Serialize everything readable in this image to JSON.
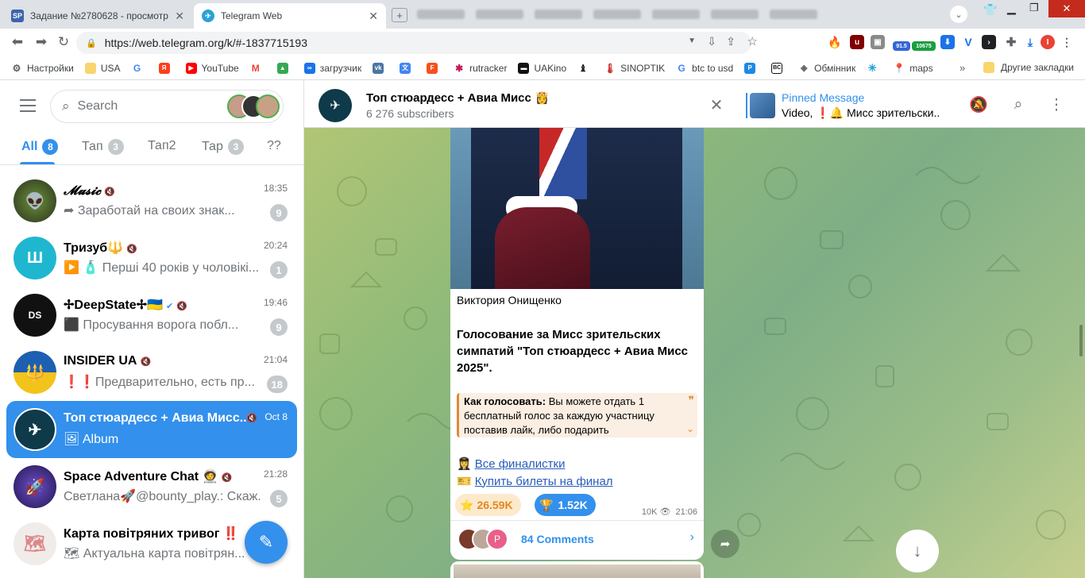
{
  "browser": {
    "tabs": [
      {
        "title": "Задание №2780628 - просмотр з",
        "favicon": "SP",
        "favicon_color": "#3c64ad"
      },
      {
        "title": "Telegram Web",
        "favicon": "✈",
        "favicon_color": "#2aa1da"
      }
    ],
    "url": "https://web.telegram.org/k/#-1837715193",
    "extension_badges": [
      "91.5",
      "10675"
    ],
    "bookmarks": [
      "Настройки",
      "USA",
      "YouTube",
      "загрузчик",
      "rutracker",
      "UAKino",
      "SINOPTIK",
      "btc to usd",
      "Обмінник",
      "maps"
    ],
    "other_bookmarks": "Другие закладки"
  },
  "sidebar": {
    "search_placeholder": "Search",
    "folders": [
      {
        "label": "All",
        "count": "8"
      },
      {
        "label": "Тап",
        "count": "3"
      },
      {
        "label": "Тап2",
        "count": ""
      },
      {
        "label": "Тар",
        "count": "3"
      },
      {
        "label": "??",
        "count": ""
      }
    ],
    "chats": [
      {
        "name": "𝓜𝓾𝓼𝓲𝓬",
        "time": "18:35",
        "preview": "Заработай на своих знак...",
        "badge": "9",
        "avatar_color": "#3d4b3a",
        "avatar_text": "👽"
      },
      {
        "name": "Тризуб🔱",
        "time": "20:24",
        "preview": "🧴 Перші 40 років у чоловікі...",
        "badge": "1",
        "avatar_color": "#1fb7d0",
        "avatar_text": "Ш"
      },
      {
        "name": "✢DeepState✢🇺🇦",
        "time": "19:46",
        "preview": "Просування ворога побл...",
        "badge": "9",
        "avatar_color": "#111111",
        "avatar_text": "DS"
      },
      {
        "name": "INSIDER UA",
        "time": "21:04",
        "preview": "❗❗Предварительно, есть пр...",
        "badge": "18",
        "avatar_color": "#1d5fb0",
        "avatar_text": "🔱"
      },
      {
        "name": "Топ стюардесс + Авиа Мисс...",
        "time": "Oct 8",
        "preview": "Album",
        "badge": "",
        "avatar_color": "#0e3a4a",
        "avatar_text": "✈"
      },
      {
        "name": "Space Adventure Chat 🧑‍🚀",
        "time": "21:28",
        "preview": "Светлана🚀@bounty_play.: Скаж...",
        "badge": "5",
        "avatar_color": "#3a2a7a",
        "avatar_text": "🚀"
      },
      {
        "name": "Карта повітряних тривог ‼️",
        "time": "",
        "preview": "Актуальна карта повітрян...",
        "badge": "",
        "avatar_color": "#eeeeee",
        "avatar_text": "🗺"
      }
    ]
  },
  "channel": {
    "title": "Топ стюардесс + Авиа Мисс 👸",
    "subtitle": "6 276 subscribers",
    "pinned_label": "Pinned Message",
    "pinned_text": "Video, ❗🔔 Мисс зрительски..."
  },
  "message": {
    "author": "Виктория Онищенко",
    "body": "Голосование за Мисс зрительских симпатий \"Топ стюардесс + Авиа Мисс 2025\".",
    "quote_bold": "Как голосовать:",
    "quote_text": " Вы можете отдать 1 бесплатный голос за каждую участницу поставив лайк, либо подарить",
    "link1": "Все финалистки",
    "link2": "Купить билеты на финал",
    "reactions": [
      {
        "emoji": "⭐",
        "count": "26.59K"
      },
      {
        "emoji": "🏆",
        "count": "1.52K"
      }
    ],
    "views": "10K",
    "time": "21:06",
    "comments": "84 Comments"
  }
}
